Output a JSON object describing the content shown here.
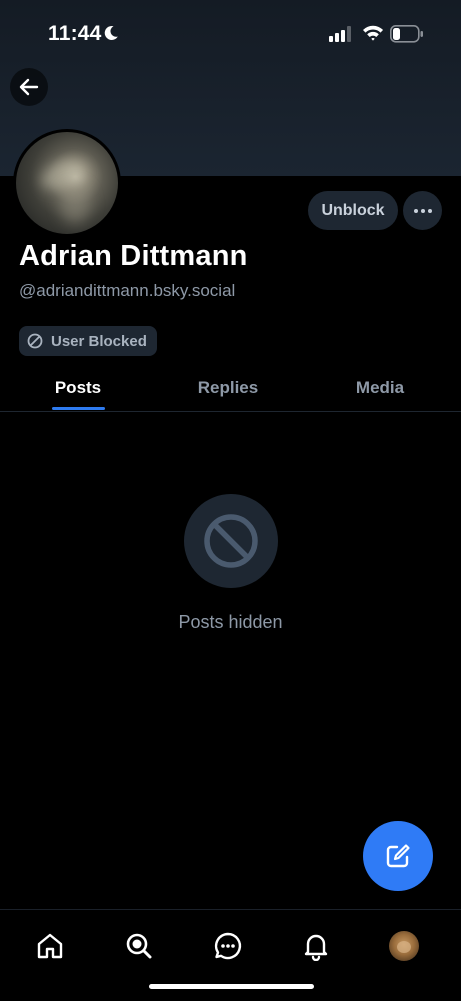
{
  "status_bar": {
    "time": "11:44"
  },
  "profile": {
    "display_name": "Adrian Dittmann",
    "handle": "@adriandittmann.bsky.social",
    "blocked_badge": "User Blocked"
  },
  "actions": {
    "unblock_label": "Unblock"
  },
  "tabs": [
    {
      "label": "Posts",
      "active": true
    },
    {
      "label": "Replies",
      "active": false
    },
    {
      "label": "Media",
      "active": false
    }
  ],
  "empty_state": {
    "text": "Posts hidden"
  },
  "colors": {
    "accent": "#2f7bf6",
    "background": "#000000",
    "muted_text": "#8e99a7"
  },
  "icons": {
    "back": "arrow-left-icon",
    "more": "ellipsis-icon",
    "blocked": "block-icon",
    "compose": "compose-icon",
    "nav": [
      "home-icon",
      "search-icon",
      "chat-icon",
      "bell-icon",
      "profile-avatar"
    ]
  }
}
